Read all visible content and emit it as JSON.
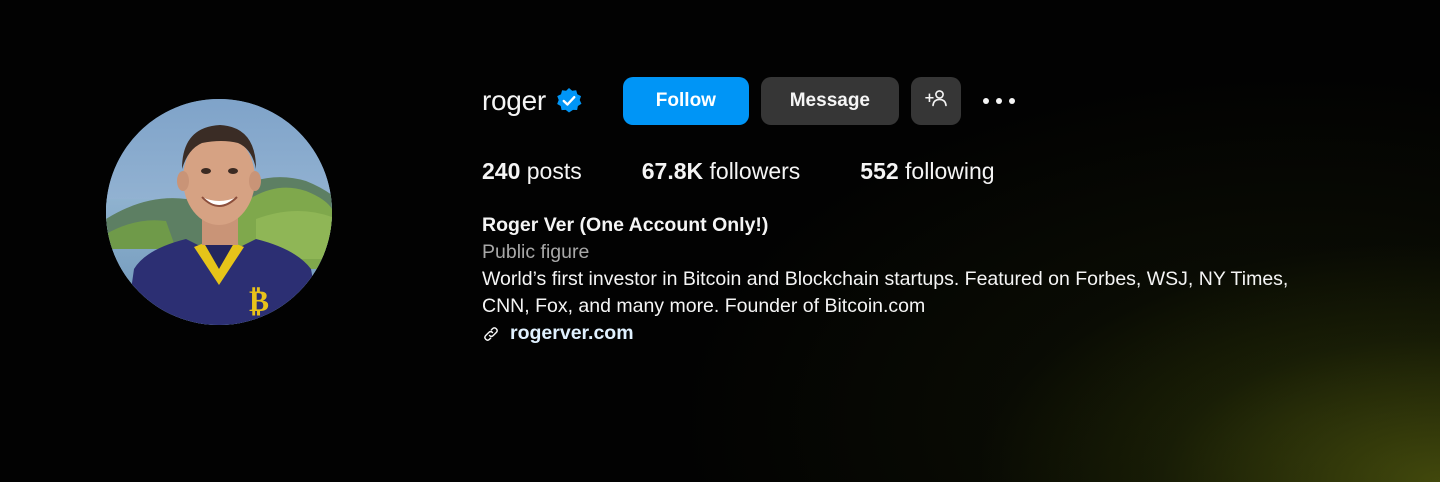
{
  "profile": {
    "username": "roger",
    "verified": true,
    "avatar_alt": "profile-photo",
    "buttons": {
      "follow": "Follow",
      "message": "Message"
    },
    "stats": {
      "posts": {
        "value": "240",
        "label": "posts"
      },
      "followers": {
        "value": "67.8K",
        "label": "followers"
      },
      "following": {
        "value": "552",
        "label": "following"
      }
    },
    "full_name": "Roger Ver (One Account Only!)",
    "category": "Public figure",
    "bio_line1": "World’s first investor in Bitcoin and Blockchain startups. Featured on Forbes, WSJ, NY Times,",
    "bio_line2": "CNN, Fox, and many more. Founder of Bitcoin.com",
    "website": "rogerver.com"
  },
  "icons": {
    "verified": "verified-badge-icon",
    "suggest": "add-person-icon",
    "more": "more-options-icon",
    "link": "link-icon"
  },
  "colors": {
    "follow_blue": "#0095f6",
    "verified_blue": "#0095f6",
    "secondary_button": "#363636",
    "muted_text": "#a8a8a8",
    "link_text": "#e0f1ff"
  }
}
